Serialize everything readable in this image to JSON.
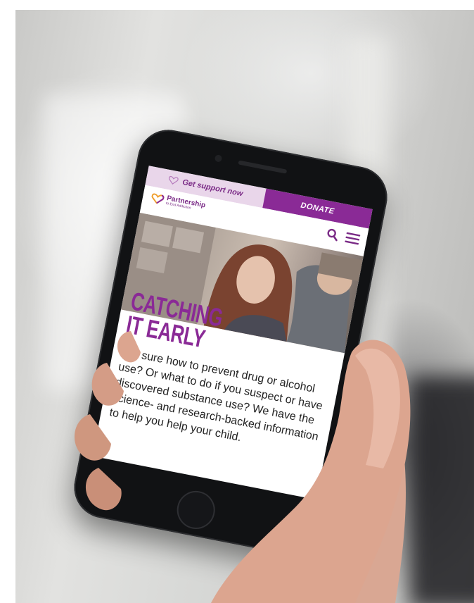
{
  "screen": {
    "topbar": {
      "support_label": "Get support now",
      "donate_label": "DONATE"
    },
    "navbar": {
      "logo_name": "Partnership",
      "logo_tagline": "to End Addiction",
      "search_icon": "search-icon",
      "menu_icon": "hamburger-menu-icon"
    },
    "hero": {
      "headline_line1": "CATCHING",
      "headline_line2": "IT EARLY",
      "body": "Not sure how to prevent drug or alcohol use? Or what to do if you suspect or have discovered substance use? We have the science- and research-backed information to help you help your child."
    }
  },
  "colors": {
    "brand_purple": "#8a2a96",
    "support_bg": "#e9d6ea",
    "phone_body": "#111214"
  }
}
